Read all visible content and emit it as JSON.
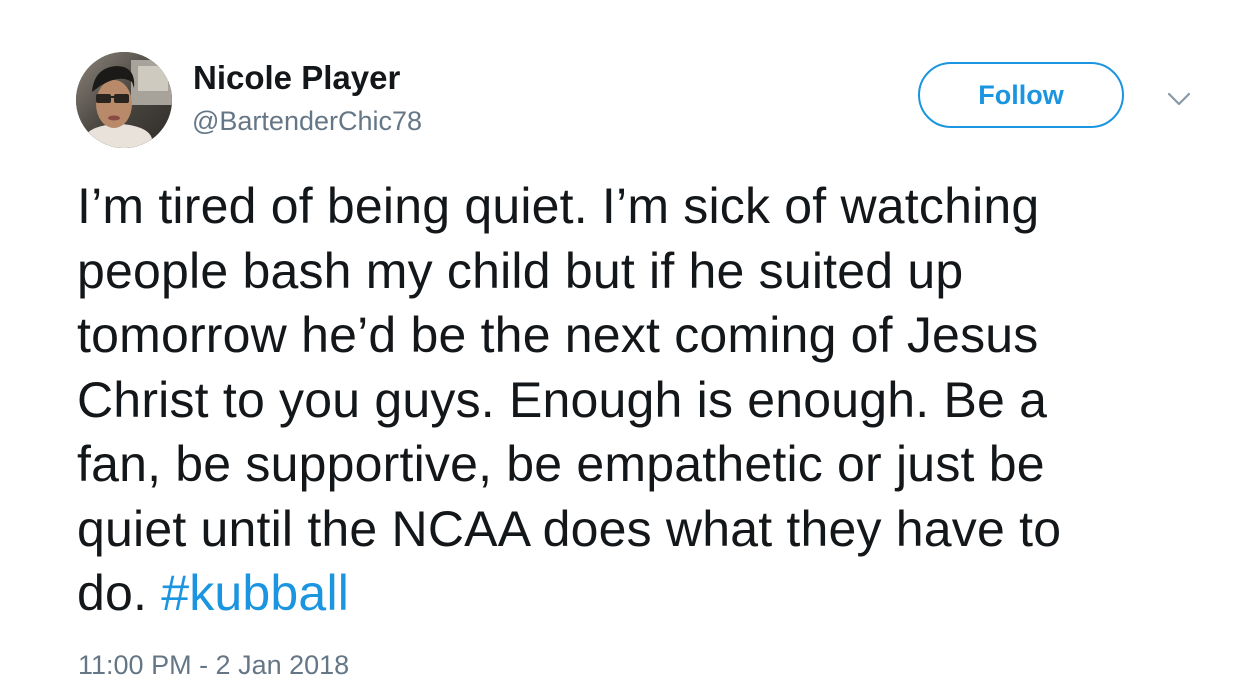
{
  "user": {
    "display_name": "Nicole Player",
    "handle": "@BartenderChic78"
  },
  "actions": {
    "follow_label": "Follow",
    "menu_icon": "chevron-down-icon"
  },
  "tweet": {
    "lines": [
      "I’m tired of being quiet. I’m sick of watching",
      "people bash my child but if he suited up",
      "tomorrow he’d be the next coming of Jesus",
      "Christ to you guys. Enough is enough. Be a",
      "fan, be supportive, be empathetic or just be",
      "quiet until the NCAA does what they have to"
    ],
    "last_line_text": "do. ",
    "hashtag": "#kubball",
    "timestamp": "11:00 PM - 2 Jan 2018"
  },
  "colors": {
    "text": "#14171a",
    "secondary": "#657786",
    "accent": "#1b95e0",
    "background": "#ffffff"
  }
}
